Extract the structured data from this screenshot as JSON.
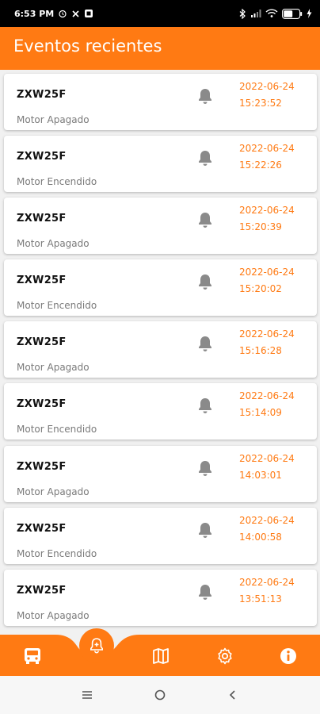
{
  "status_bar": {
    "time": "6:53 PM",
    "icons_left": [
      "alarm-icon",
      "x-app-icon",
      "app-icon"
    ],
    "icons_right": [
      "bluetooth-icon",
      "signal-icon",
      "wifi-icon",
      "battery-icon",
      "charging-icon"
    ],
    "battery_level": "58"
  },
  "header": {
    "title": "Eventos recientes"
  },
  "events": [
    {
      "plate": "ZXW25F",
      "event": "Motor Apagado",
      "date": "2022-06-24",
      "time": "15:23:52"
    },
    {
      "plate": "ZXW25F",
      "event": "Motor Encendido",
      "date": "2022-06-24",
      "time": "15:22:26"
    },
    {
      "plate": "ZXW25F",
      "event": "Motor Apagado",
      "date": "2022-06-24",
      "time": "15:20:39"
    },
    {
      "plate": "ZXW25F",
      "event": "Motor Encendido",
      "date": "2022-06-24",
      "time": "15:20:02"
    },
    {
      "plate": "ZXW25F",
      "event": "Motor Apagado",
      "date": "2022-06-24",
      "time": "15:16:28"
    },
    {
      "plate": "ZXW25F",
      "event": "Motor Encendido",
      "date": "2022-06-24",
      "time": "15:14:09"
    },
    {
      "plate": "ZXW25F",
      "event": "Motor Apagado",
      "date": "2022-06-24",
      "time": "14:03:01"
    },
    {
      "plate": "ZXW25F",
      "event": "Motor Encendido",
      "date": "2022-06-24",
      "time": "14:00:58"
    },
    {
      "plate": "ZXW25F",
      "event": "Motor Apagado",
      "date": "2022-06-24",
      "time": "13:51:13"
    }
  ],
  "bottom_nav": {
    "items": [
      "bus-icon",
      "alarm-bell-icon",
      "map-icon",
      "settings-icon",
      "info-icon"
    ],
    "active": "alarm-bell-icon"
  },
  "colors": {
    "accent": "#ff7a13",
    "background": "#f1f1f1",
    "card": "#ffffff",
    "muted_text": "#7a7a7a",
    "bell": "#8a8a8a"
  }
}
